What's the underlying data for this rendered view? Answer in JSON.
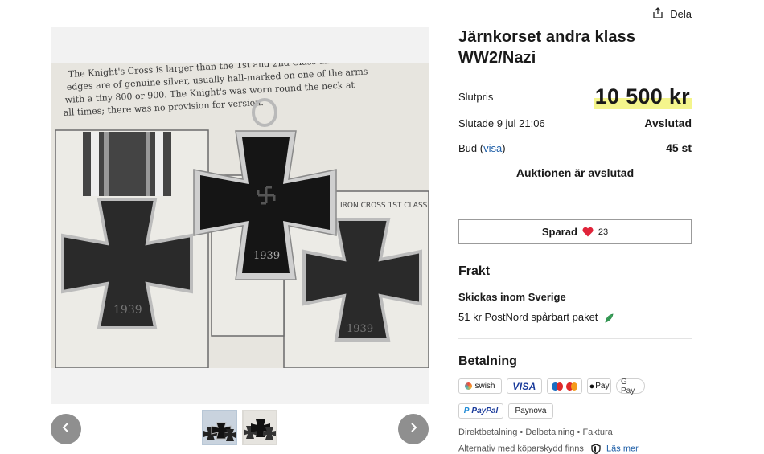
{
  "header": {
    "share_label": "Dela"
  },
  "listing": {
    "title": "Järnkorset andra klass WW2/Nazi",
    "final_price_label": "Slutpris",
    "final_price": "10 500 kr",
    "ended_label": "Slutade 9 jul 21:06",
    "status": "Avslutad",
    "bids_label": "Bud (",
    "bids_link": "visa",
    "bids_label_end": ")",
    "bids_count": "45 st",
    "auction_ended": "Auktionen är avslutad",
    "saved_label": "Sparad",
    "saved_count": "23"
  },
  "shipping": {
    "heading": "Frakt",
    "region": "Skickas inom Sverige",
    "option": "51 kr PostNord spårbart paket"
  },
  "payment": {
    "heading": "Betalning",
    "methods_row1": [
      "swish",
      "VISA",
      "Maestro/Mastercard",
      "Pay",
      "G Pay"
    ],
    "methods_row2": [
      "PayPal",
      "Paynova"
    ],
    "types": "Direktbetalning • Delbetalning • Faktura",
    "protection": "Alternativ med köparskydd finns",
    "learn_more": "Läs mer"
  },
  "gallery": {
    "thumb_count": 2,
    "active_thumb": 1
  },
  "colors": {
    "price_highlight": "#f4f58c",
    "heart": "#e0243a",
    "link": "#1f5fa8",
    "nav_button": "#8f8f8f"
  },
  "icons": [
    "share-icon",
    "chevron-left-icon",
    "chevron-right-icon",
    "heart-icon",
    "leaf-icon",
    "shield-icon"
  ]
}
